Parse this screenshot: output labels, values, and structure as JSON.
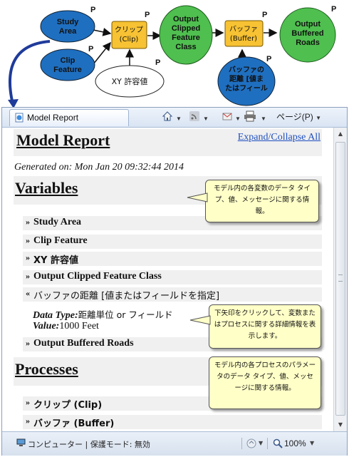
{
  "diagram": {
    "nodes": {
      "study_area": "Study\nArea",
      "clip_feature": "Clip\nFeature",
      "xy_tolerance": "XY 許容値",
      "clip_tool": "クリップ\n(Clip)",
      "output_clipped": "Output\nClipped\nFeature\nClass",
      "buffer_tool": "バッファ\n(Buffer)",
      "buffer_distance": "バッファの\n距離 [値ま\nたはフィール",
      "output_buffered": "Output\nBuffered\nRoads"
    },
    "p": "P"
  },
  "browser": {
    "tab_title": "Model Report",
    "page_menu": "ページ(P)",
    "status_text": "コンピューター | 保護モード: 無効",
    "zoom": "100%"
  },
  "report": {
    "title": "Model Report",
    "expand_link": "Expand/Collapse All",
    "generated": "Generated on: Mon Jan 20 09:32:44 2014",
    "variables_heading": "Variables",
    "variables": [
      {
        "label": "Study Area"
      },
      {
        "label": "Clip Feature"
      },
      {
        "label": "XY 許容値"
      },
      {
        "label": "Output Clipped Feature Class"
      },
      {
        "label": "バッファの距離 [値またはフィールドを指定]"
      },
      {
        "label": "Output Buffered Roads"
      }
    ],
    "detail": {
      "type_label": "Data Type:",
      "type_value": "距離単位 or フィールド",
      "value_label": "Value:",
      "value_value": "1000 Feet"
    },
    "processes_heading": "Processes",
    "processes": [
      {
        "label": "クリップ (Clip)"
      },
      {
        "label": "バッファ (Buffer)"
      }
    ],
    "collapsed_arrow": "»",
    "expanded_arrow": "«"
  },
  "callouts": {
    "variables": "モデル内の各変数のデータ タイプ、値、メッセージに関する情報。",
    "arrow": "下矢印をクリックして、変数またはプロセスに関する詳細情報を表示します。",
    "processes": "モデル内の各プロセスのパラメータのデータ タイプ、値、メッセージに関する情報。"
  },
  "colors": {
    "variable_node": "#1f6fc0",
    "tool_node": "#f7c233",
    "output_node": "#4fbf4f",
    "callout_bg": "#ffffc8",
    "link": "#1f4fbf"
  }
}
